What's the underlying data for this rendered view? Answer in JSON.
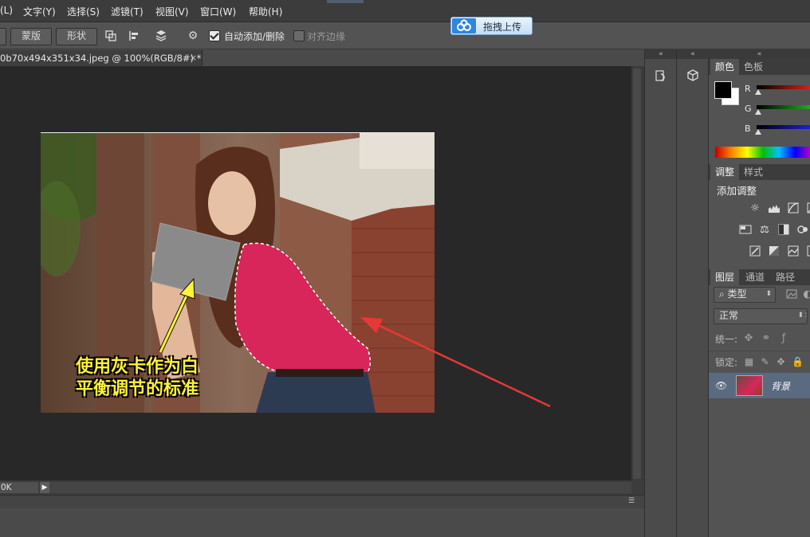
{
  "menu": {
    "items": [
      "(L)",
      "文字(Y)",
      "选择(S)",
      "滤镜(T)",
      "视图(V)",
      "窗口(W)",
      "帮助(H)"
    ]
  },
  "options_bar": {
    "mask_button": "蒙版",
    "shape_button": "形状",
    "auto_add_delete": "自动添加/删除",
    "align_edges": "对齐边缘",
    "auto_add_checked": true,
    "align_edges_checked": false
  },
  "upload": {
    "label": "拖拽上传"
  },
  "document": {
    "tab_title": "0b70x494x351x34.jpeg @ 100%(RGB/8#) *",
    "tab_close": "×",
    "zoom": "0K"
  },
  "photo_annotation": {
    "line1": "使用灰卡作为白",
    "line2": "平衡调节的标准"
  },
  "color_panel": {
    "tabs": [
      "颜色",
      "色板"
    ],
    "channels": [
      "R",
      "G",
      "B"
    ],
    "channel_colors": [
      "#e02020",
      "#22b022",
      "#2020e0"
    ]
  },
  "adjust_panel": {
    "tabs": [
      "调整",
      "样式"
    ],
    "title": "添加调整"
  },
  "layers_panel": {
    "tabs": [
      "图层",
      "通道",
      "路径"
    ],
    "filter": "类型",
    "blend_mode": "正常",
    "unify_label": "统一:",
    "lock_label": "锁定:",
    "layer_name": "背景"
  },
  "colors": {
    "accent": "#2f86e0",
    "annotation_text": "#fff23a",
    "arrow_red": "#e53935"
  }
}
